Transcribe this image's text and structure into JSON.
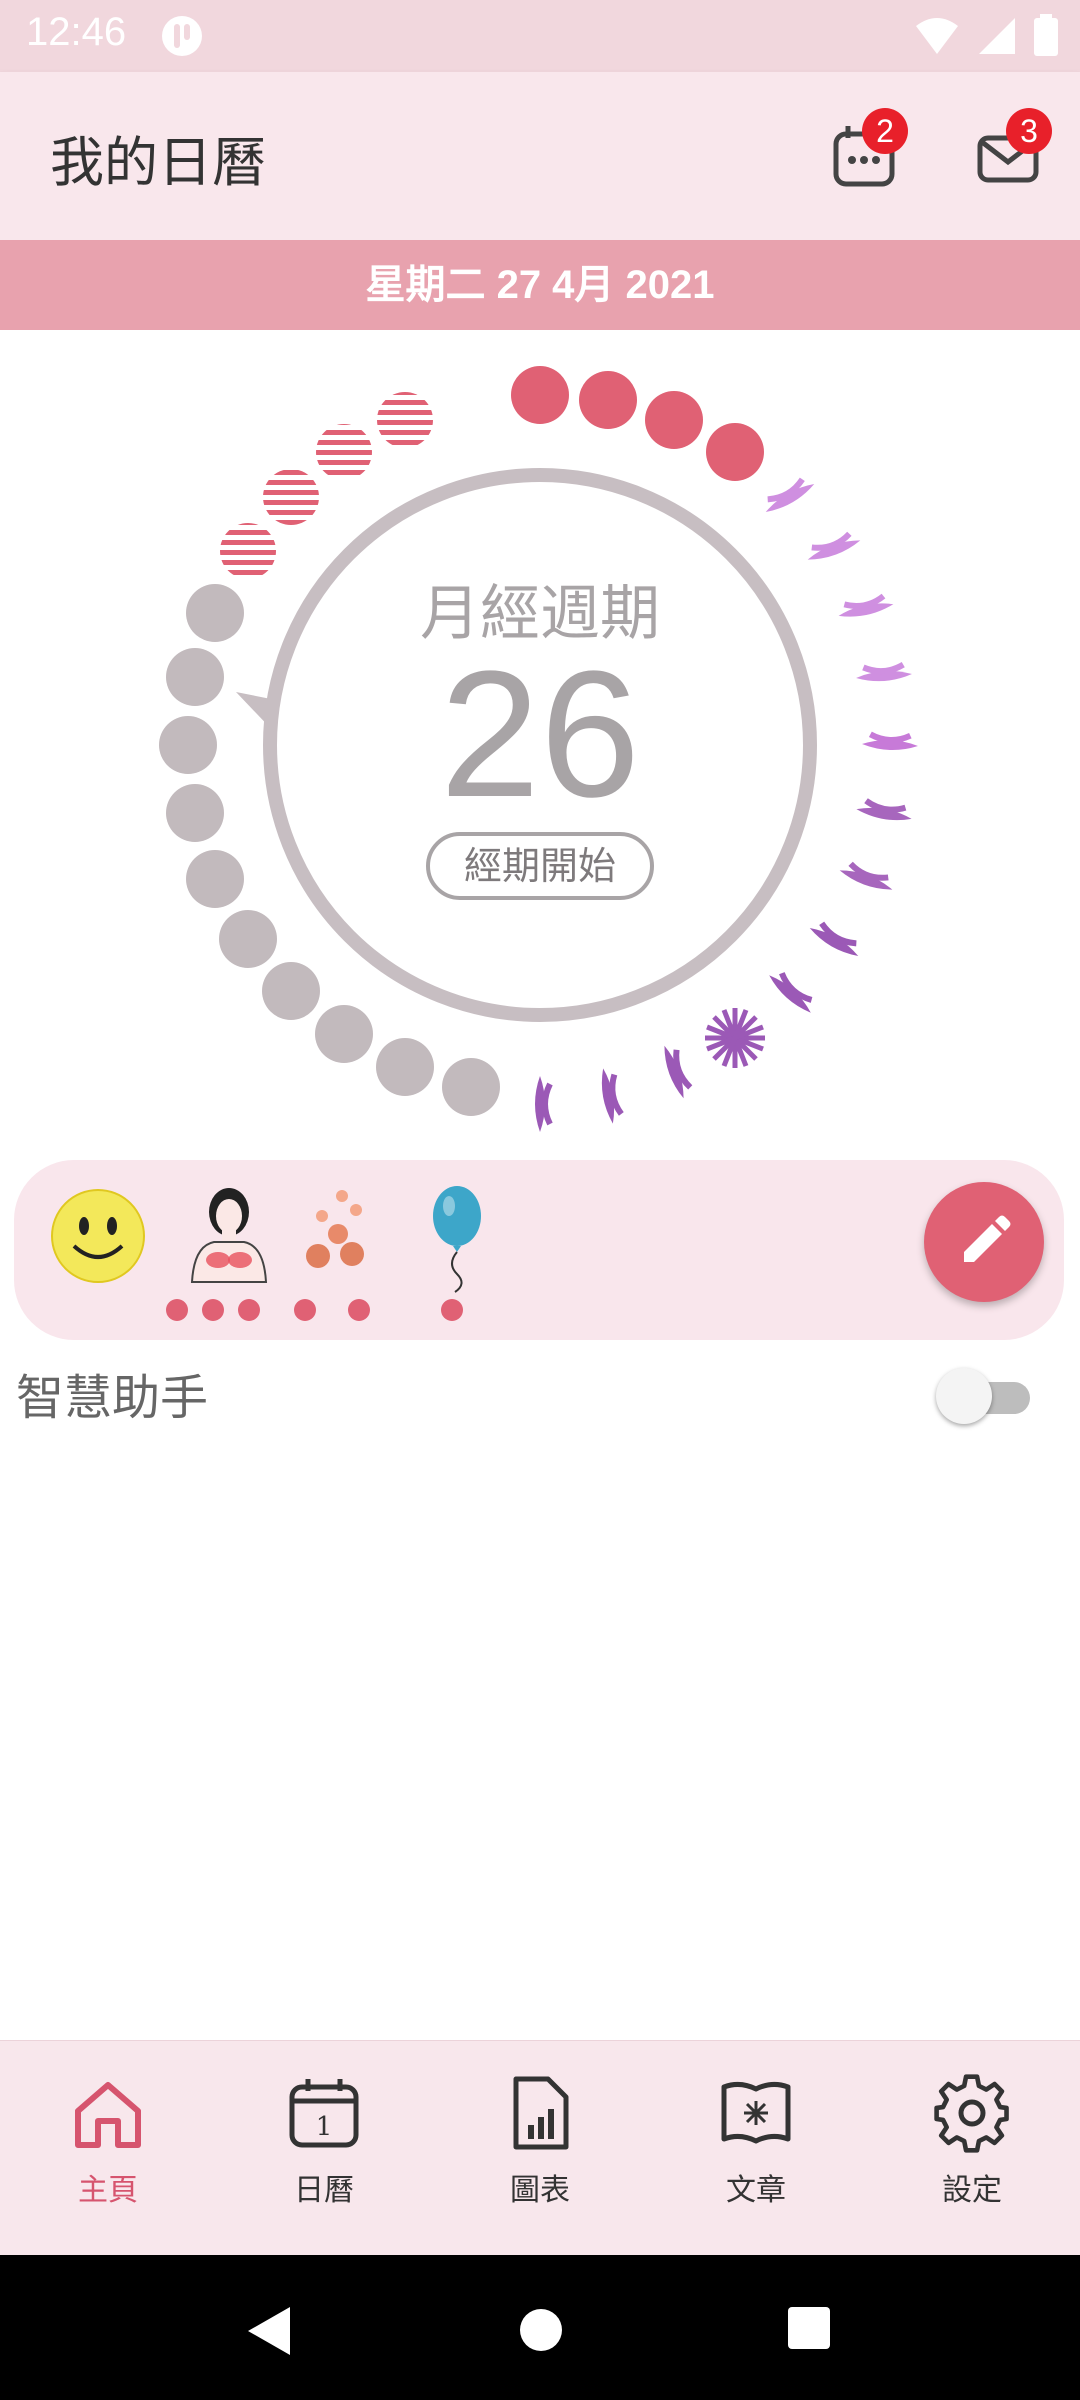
{
  "status_bar": {
    "time": "12:46"
  },
  "app_bar": {
    "title": "我的日曆",
    "calendar_badge": "2",
    "inbox_badge": "3"
  },
  "date_bar": {
    "date_text": "星期二 27 4月 2021"
  },
  "cycle": {
    "title": "月經週期",
    "day_number": "26",
    "status_pill": "經期開始"
  },
  "symptoms": {
    "items": [
      {
        "icon": "smiley-face-icon",
        "dots": 0
      },
      {
        "icon": "breast-pain-icon",
        "dots": 3
      },
      {
        "icon": "acne-icon",
        "dots": 2
      },
      {
        "icon": "balloon-icon",
        "dots": 1
      }
    ]
  },
  "assistant": {
    "label": "智慧助手",
    "enabled": false
  },
  "bottom_nav": {
    "items": [
      {
        "label": "主頁",
        "icon": "home-icon",
        "active": true
      },
      {
        "label": "日曆",
        "icon": "calendar-icon",
        "active": false
      },
      {
        "label": "圖表",
        "icon": "chart-icon",
        "active": false
      },
      {
        "label": "文章",
        "icon": "article-icon",
        "active": false
      },
      {
        "label": "設定",
        "icon": "gear-icon",
        "active": false
      }
    ]
  },
  "colors": {
    "accent": "#e06174",
    "period_dot": "#e06174",
    "grey_dot": "#c2babd",
    "ovulation_leaf": "#9b59b6"
  }
}
